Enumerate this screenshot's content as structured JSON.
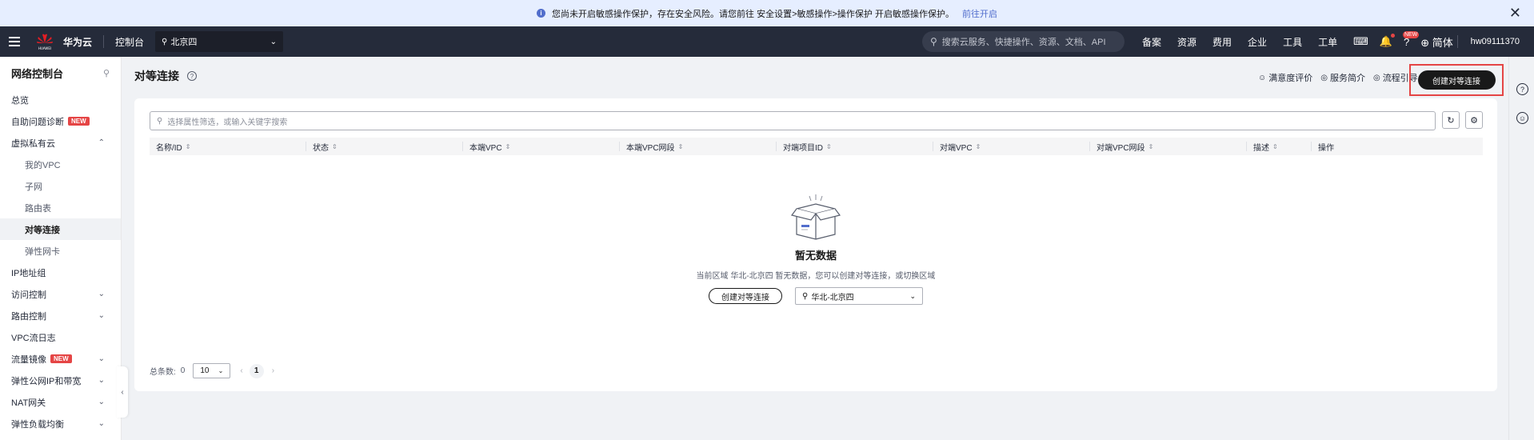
{
  "notice": {
    "message": "您尚未开启敏感操作保护，存在安全风险。请您前往 安全设置>敏感操作>操作保护 开启敏感操作保护。",
    "link": "前往开启"
  },
  "header": {
    "brand": "华为云",
    "console": "控制台",
    "region": "北京四",
    "search_placeholder": "搜索云服务、快捷操作、资源、文档、API",
    "nav": [
      "备案",
      "资源",
      "费用",
      "企业",
      "工具",
      "工单"
    ],
    "new_badge": "NEW",
    "language": "简体",
    "user": "hw09111370"
  },
  "sidebar": {
    "title": "网络控制台",
    "items": [
      {
        "label": "总览"
      },
      {
        "label": "自助问题诊断",
        "badge": "NEW"
      },
      {
        "label": "虚拟私有云"
      },
      {
        "label": "我的VPC"
      },
      {
        "label": "子网"
      },
      {
        "label": "路由表"
      },
      {
        "label": "对等连接"
      },
      {
        "label": "弹性网卡"
      },
      {
        "label": "IP地址组"
      },
      {
        "label": "访问控制"
      },
      {
        "label": "路由控制"
      },
      {
        "label": "VPC流日志"
      },
      {
        "label": "流量镜像",
        "badge": "NEW"
      },
      {
        "label": "弹性公网IP和带宽"
      },
      {
        "label": "NAT网关"
      },
      {
        "label": "弹性负载均衡"
      }
    ]
  },
  "main": {
    "title": "对等连接",
    "links": [
      "满意度评价",
      "服务简介",
      "流程引导"
    ],
    "create_button": "创建对等连接",
    "filter_placeholder": "选择属性筛选，或输入关键字搜索",
    "columns": [
      "名称/ID",
      "状态",
      "本端VPC",
      "本端VPC网段",
      "对端项目ID",
      "对端VPC",
      "对端VPC网段",
      "描述",
      "操作"
    ],
    "empty": {
      "title": "暂无数据",
      "desc": "当前区域 华北-北京四 暂无数据，您可以创建对等连接，或切换区域",
      "create_label": "创建对等连接",
      "region_select": "华北-北京四"
    },
    "pager": {
      "total_label": "总条数:",
      "total": "0",
      "page_size": "10",
      "page": "1"
    }
  }
}
